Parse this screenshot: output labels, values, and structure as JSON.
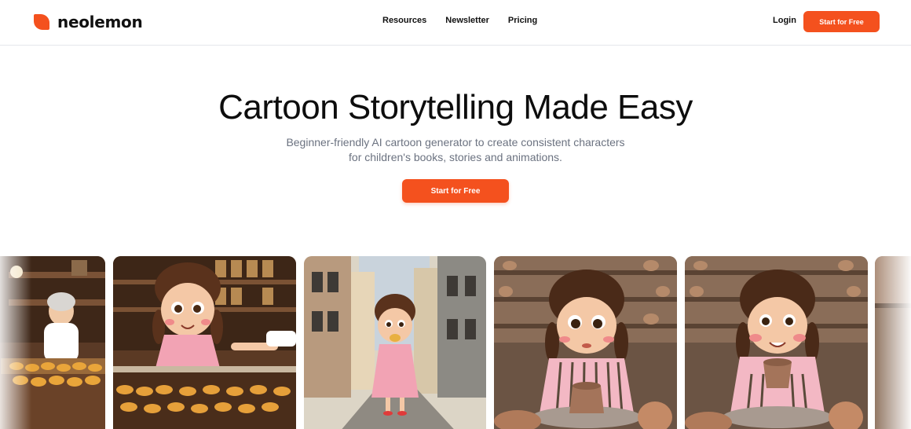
{
  "brand": {
    "name": "neolemon",
    "accent_color": "#f4511e"
  },
  "nav": {
    "items": [
      {
        "label": "Resources"
      },
      {
        "label": "Newsletter"
      },
      {
        "label": "Pricing"
      }
    ],
    "login_label": "Login",
    "cta_label": "Start for Free"
  },
  "hero": {
    "title": "Cartoon Storytelling Made Easy",
    "subtitle_line1": "Beginner-friendly AI cartoon generator to create consistent characters",
    "subtitle_line2": "for children's books, stories and animations.",
    "cta_label": "Start for Free"
  },
  "gallery": {
    "images": [
      {
        "icon": "grandma-bakery-image"
      },
      {
        "icon": "girl-bakery-counter-image"
      },
      {
        "icon": "girl-street-eating-image"
      },
      {
        "icon": "girl-pottery-wheel-image"
      },
      {
        "icon": "girl-holding-cup-image"
      },
      {
        "icon": "partial-next-image"
      }
    ]
  }
}
